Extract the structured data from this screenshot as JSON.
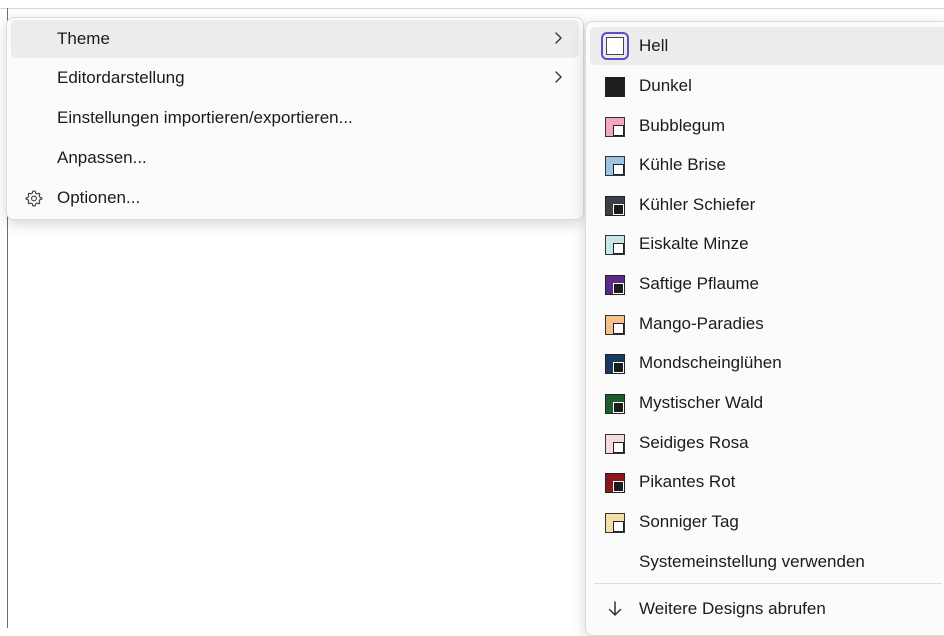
{
  "menu": {
    "items": [
      {
        "label": "Theme",
        "has_submenu": true
      },
      {
        "label": "Editordarstellung",
        "has_submenu": true
      },
      {
        "label": "Einstellungen importieren/exportieren..."
      },
      {
        "label": "Anpassen..."
      },
      {
        "label": "Optionen...",
        "icon": "gear-icon"
      }
    ]
  },
  "theme_submenu": {
    "items": [
      {
        "label": "Hell",
        "selected": true,
        "color": "#ffffff",
        "corner": "#ffffff"
      },
      {
        "label": "Dunkel",
        "color": "#1f1f1f",
        "corner": "#1f1f1f"
      },
      {
        "label": "Bubblegum",
        "color": "#f2a7c4",
        "corner": "#ffffff"
      },
      {
        "label": "Kühle Brise",
        "color": "#9cc3e4",
        "corner": "#ffffff"
      },
      {
        "label": "Kühler Schiefer",
        "color": "#3a3f4a",
        "corner": "#ffffff"
      },
      {
        "label": "Eiskalte Minze",
        "color": "#c8e6e6",
        "corner": "#ffffff"
      },
      {
        "label": "Saftige Pflaume",
        "color": "#5b2a86",
        "corner": "#ffffff"
      },
      {
        "label": "Mango-Paradies",
        "color": "#f6c08a",
        "corner": "#ffffff"
      },
      {
        "label": "Mondscheinglühen",
        "color": "#173a63",
        "corner": "#ffffff"
      },
      {
        "label": "Mystischer Wald",
        "color": "#1e5b2e",
        "corner": "#ffffff"
      },
      {
        "label": "Seidiges Rosa",
        "color": "#f5dada",
        "corner": "#ffffff"
      },
      {
        "label": "Pikantes Rot",
        "color": "#8a1620",
        "corner": "#ffffff"
      },
      {
        "label": "Sonniger Tag",
        "color": "#f2dfa6",
        "corner": "#ffffff"
      },
      {
        "label": "Systemeinstellung verwenden"
      }
    ],
    "more": {
      "label": "Weitere Designs abrufen",
      "icon": "arrow-down-icon"
    }
  }
}
